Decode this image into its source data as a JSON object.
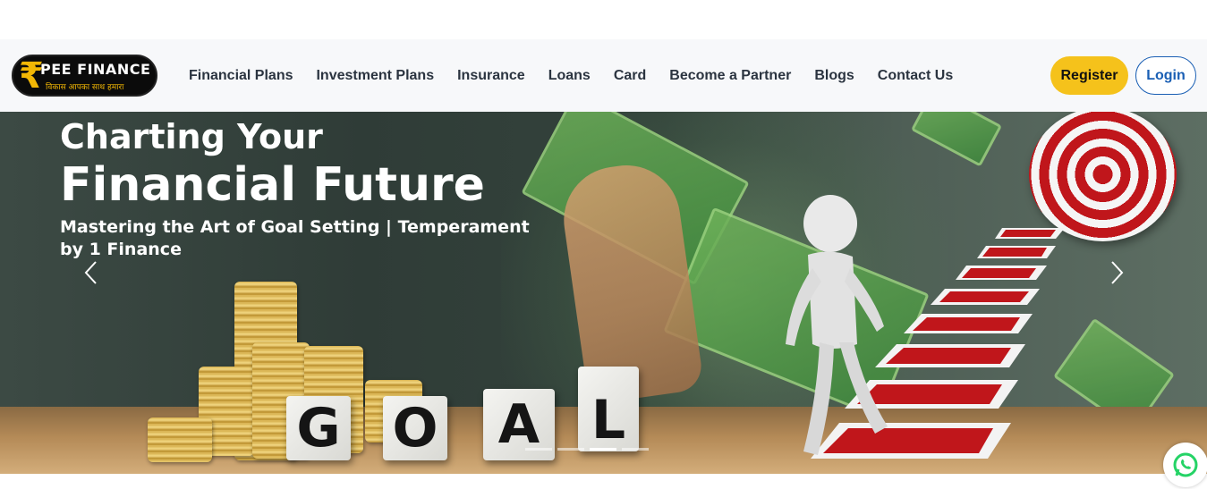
{
  "header": {
    "logo": {
      "rupee_symbol": "₹",
      "brand": "PEE FINANCE",
      "tagline": "विकास आपका   साथ हमारा"
    },
    "nav": [
      {
        "label": "Financial Plans",
        "icon": null
      },
      {
        "label": "Investment Plans",
        "icon": null
      },
      {
        "label": "Insurance",
        "icon": null
      },
      {
        "label": "Loans",
        "icon": null
      },
      {
        "label": "Card",
        "icon": null
      },
      {
        "label": "Become a Partner",
        "icon": null
      },
      {
        "label": "Blogs",
        "icon": null
      },
      {
        "label": "Contact Us",
        "icon": null
      }
    ],
    "register_label": "Register",
    "login_label": "Login"
  },
  "hero": {
    "title_line1": "Charting Your",
    "title_line2": "Financial Future",
    "subtitle": "Mastering the Art of Goal Setting | Temperament by 1 Finance",
    "goal_letters": [
      "G",
      "O",
      "A",
      "L"
    ],
    "prev_icon": "chevron-left-icon",
    "next_icon": "chevron-right-icon",
    "indicators": {
      "count": 4,
      "active_index": 2
    }
  },
  "floating": {
    "whatsapp_icon": "whatsapp-icon"
  },
  "colors": {
    "accent_yellow": "#f5c21b",
    "login_blue": "#1a5fb4",
    "nav_text": "#2b3440",
    "whatsapp_green": "#25d366"
  }
}
